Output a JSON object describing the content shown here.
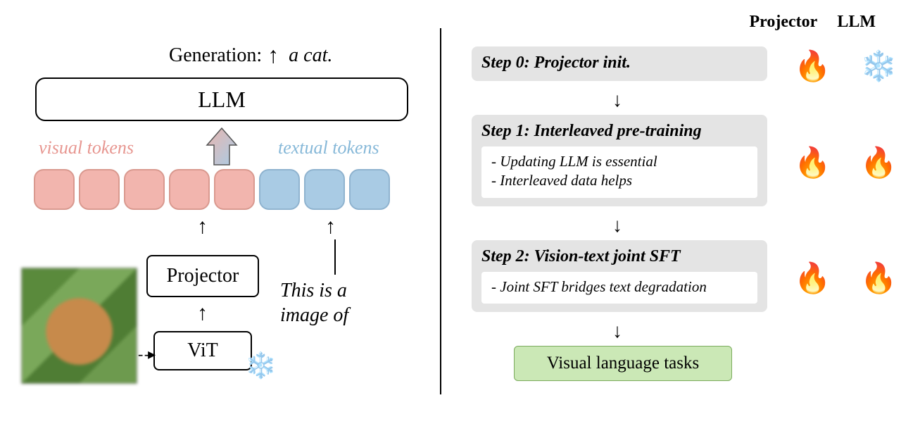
{
  "left": {
    "generation_label": "Generation:",
    "generation_output": "a cat.",
    "llm": "LLM",
    "visual_tokens_label": "visual tokens",
    "textual_tokens_label": "textual tokens",
    "projector": "Projector",
    "vit": "ViT",
    "prompt_line1": "This is a",
    "prompt_line2": "image of",
    "snow_icon": "❄️",
    "cat_alt": "pixelated-cat-image"
  },
  "right": {
    "header_projector": "Projector",
    "header_llm": "LLM",
    "step0": {
      "title": "Step 0: Projector init.",
      "proj_icon": "🔥",
      "llm_icon": "❄️"
    },
    "step1": {
      "title": "Step 1: Interleaved pre-training",
      "bullet1": "-  Updating LLM is essential",
      "bullet2": "-  Interleaved data helps",
      "proj_icon": "🔥",
      "llm_icon": "🔥"
    },
    "step2": {
      "title": "Step 2: Vision-text joint SFT",
      "bullet1": "-  Joint SFT bridges text degradation",
      "proj_icon": "🔥",
      "llm_icon": "🔥"
    },
    "final": "Visual language tasks"
  }
}
